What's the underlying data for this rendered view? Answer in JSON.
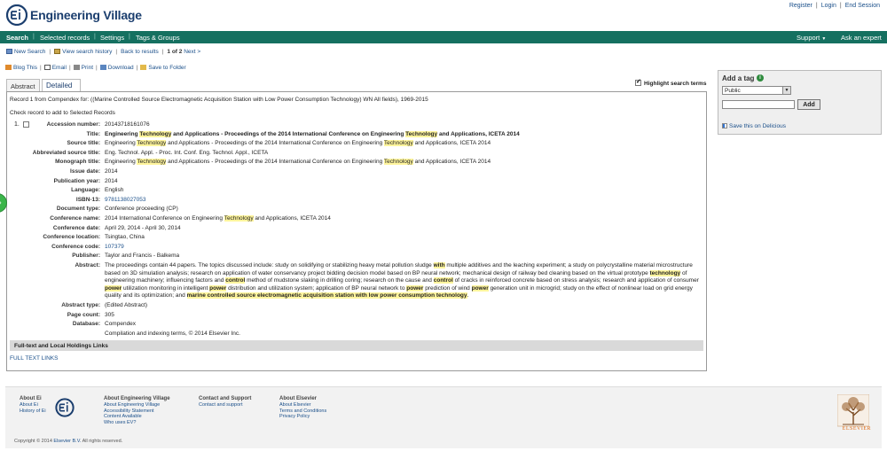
{
  "header": {
    "logo_text": "Engineering Village",
    "user_links": [
      "Register",
      "Login",
      "End Session"
    ]
  },
  "nav": {
    "left": [
      "Search",
      "Selected records",
      "Settings",
      "Tags & Groups"
    ],
    "support": "Support",
    "support_icon": "caret-down-icon",
    "ask": "Ask an expert"
  },
  "results_bar": {
    "new_search": "New Search",
    "view_history": "View search history",
    "back": "Back to results",
    "position": "1 of 2",
    "next": "Next >"
  },
  "actions": {
    "blog": "Blog This",
    "email": "Email",
    "print": "Print",
    "download": "Download",
    "save": "Save to Folder"
  },
  "tabs": [
    {
      "label": "Abstract",
      "active": false
    },
    {
      "label": "Detailed",
      "active": true
    }
  ],
  "highlight_toggle": {
    "label": "Highlight search terms",
    "checked": true
  },
  "record": {
    "caption": "Record 1 from Compendex for: ((Marine Controlled Source Electromagnetic Acquisition Station with Low Power Consumption Technology) WN All fields), 1969-2015",
    "check_caption": "Check record to add to Selected Records",
    "number": "1.",
    "fields": [
      {
        "label": "Accession number:",
        "html": "20143718161076"
      },
      {
        "label": "Title:",
        "html": "<b>Engineering <span class=\"hl\">Technology</span> and Applications - Proceedings of the 2014 International Conference on Engineering <span class=\"hl\">Technology</span> and Applications, ICETA 2014</b>"
      },
      {
        "label": "Source title:",
        "html": "Engineering <span class=\"hl\">Technology</span> and Applications - Proceedings of the 2014 International Conference on Engineering <span class=\"hl\">Technology</span> and Applications, ICETA 2014"
      },
      {
        "label": "Abbreviated source title:",
        "html": "Eng. Technol. Appl. - Proc. Int. Conf. Eng. Technol. Appl., ICETA"
      },
      {
        "label": "Monograph title:",
        "html": "Engineering <span class=\"hl\">Technology</span> and Applications - Proceedings of the 2014 International Conference on Engineering <span class=\"hl\">Technology</span> and Applications, ICETA 2014"
      },
      {
        "label": "Issue date:",
        "html": "2014"
      },
      {
        "label": "Publication year:",
        "html": "2014"
      },
      {
        "label": "Language:",
        "html": "English"
      },
      {
        "label": "ISBN-13:",
        "html": "<span class=\"link\">9781138027053</span>"
      },
      {
        "label": "Document type:",
        "html": "Conference proceeding (CP)"
      },
      {
        "label": "Conference name:",
        "html": "2014 International Conference on Engineering <span class=\"hl\">Technology</span> and Applications, ICETA 2014"
      },
      {
        "label": "Conference date:",
        "html": "April 29, 2014 - April 30, 2014"
      },
      {
        "label": "Conference location:",
        "html": "Tsingtao, China"
      },
      {
        "label": "Conference code:",
        "html": "<span class=\"link\">107379</span>"
      },
      {
        "label": "Publisher:",
        "html": "Taylor and Francis - Balkema"
      },
      {
        "label": "Abstract:",
        "html": "The proceedings contain 44 papers. The topics discussed include: study on solidifying or stabilizing heavy metal pollution sludge <span class=\"hl\"><b>with</b></span> multiple additives and the leaching experiment; a study on polycrystalline material microstructure based on 3D simulation analysis; research on application of water conservancy project bidding decision model based on BP neural network; mechanical design of railway bed cleaning based on the virtual prototype <span class=\"hl\"><b>technology</b></span> of engineering machinery; influencing factors and <span class=\"hl\"><b>control</b></span> method of mudstone slaking in drilling coring; research on the cause and <span class=\"hl\"><b>control</b></span> of cracks in reinforced concrete based on stress analysis; research and application of consumer <span class=\"hl\"><b>power</b></span> utilization monitoring in intelligent <span class=\"hl\"><b>power</b></span> distribution and utilization system; application of BP neural network to <span class=\"hl\"><b>power</b></span> prediction of wind <span class=\"hl\"><b>power</b></span> generation unit in microgrid; study on the effect of nonlinear load on grid energy quality and its optimization; and <span class=\"hl\"><b>marine controlled source electromagnetic acquisition station with low power consumption technology</b></span>."
      },
      {
        "label": "Abstract type:",
        "html": "(Edited Abstract)"
      },
      {
        "label": "Page count:",
        "html": "305"
      },
      {
        "label": "Database:",
        "html": "Compendex"
      },
      {
        "label": "",
        "html": "Compilation and indexing terms, © 2014 Elsevier Inc."
      }
    ],
    "fulltext_header": "Full-text and Local Holdings Links",
    "fulltext_link": "FULL TEXT LINKS"
  },
  "tag_panel": {
    "title": "Add a tag",
    "info_icon": "info-icon",
    "select_value": "Public",
    "input_value": "",
    "add_label": "Add",
    "delicious": "Save this on Delicious"
  },
  "footer": {
    "col1": {
      "title": "About Ei",
      "links": [
        "About Ei",
        "History of Ei"
      ]
    },
    "col2": {
      "title": "About Engineering Village",
      "links": [
        "About Engineering Village",
        "Accessibility Statement",
        "Content Available",
        "Who uses EV?"
      ]
    },
    "col3": {
      "title": "Contact and Support",
      "links": [
        "Contact and support"
      ]
    },
    "col4": {
      "title": "About Elsevier",
      "links": [
        "About Elsevier",
        "Terms and Conditions",
        "Privacy Policy"
      ]
    },
    "copyright_prefix": "Copyright © 2014 ",
    "copyright_link": "Elsevier B.V.",
    "copyright_suffix": " All rights reserved.",
    "elsevier_text": "ELSEVIER"
  },
  "colors": {
    "nav_bg": "#157060",
    "brand": "#1b3e6e",
    "highlight": "#fff59d",
    "elsevier": "#e06a12"
  }
}
